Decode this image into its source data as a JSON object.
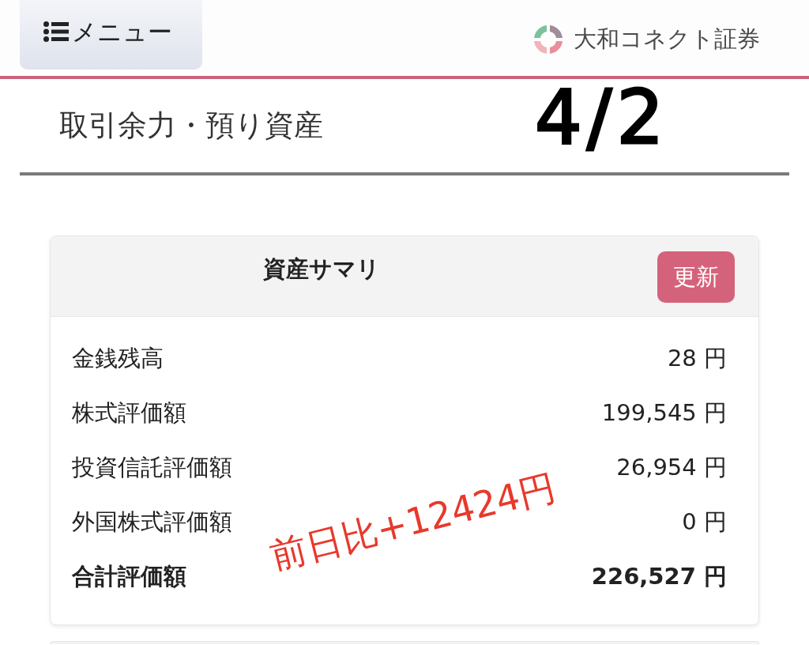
{
  "header": {
    "menu_button": {
      "label": "メニュー"
    },
    "logo": {
      "text": "大和コネクト証券"
    }
  },
  "page_title": "取引余力・預り資産",
  "annotations": [
    {
      "kind": "date",
      "text": "4/2"
    },
    {
      "kind": "note",
      "text": "前日比+12424円"
    }
  ],
  "summary_card": {
    "title": "資産サマリ",
    "refresh_button": "更新",
    "rows": [
      {
        "kind": "item",
        "label": "金銭残高",
        "value": "28 円"
      },
      {
        "kind": "item",
        "label": "株式評価額",
        "value": "199,545 円"
      },
      {
        "kind": "item",
        "label": "投資信託評価額",
        "value": "26,954 円"
      },
      {
        "kind": "item",
        "label": "外国株式評価額",
        "value": "0 円"
      },
      {
        "kind": "total",
        "label": "合計評価額",
        "value": "226,527 円"
      }
    ]
  }
}
